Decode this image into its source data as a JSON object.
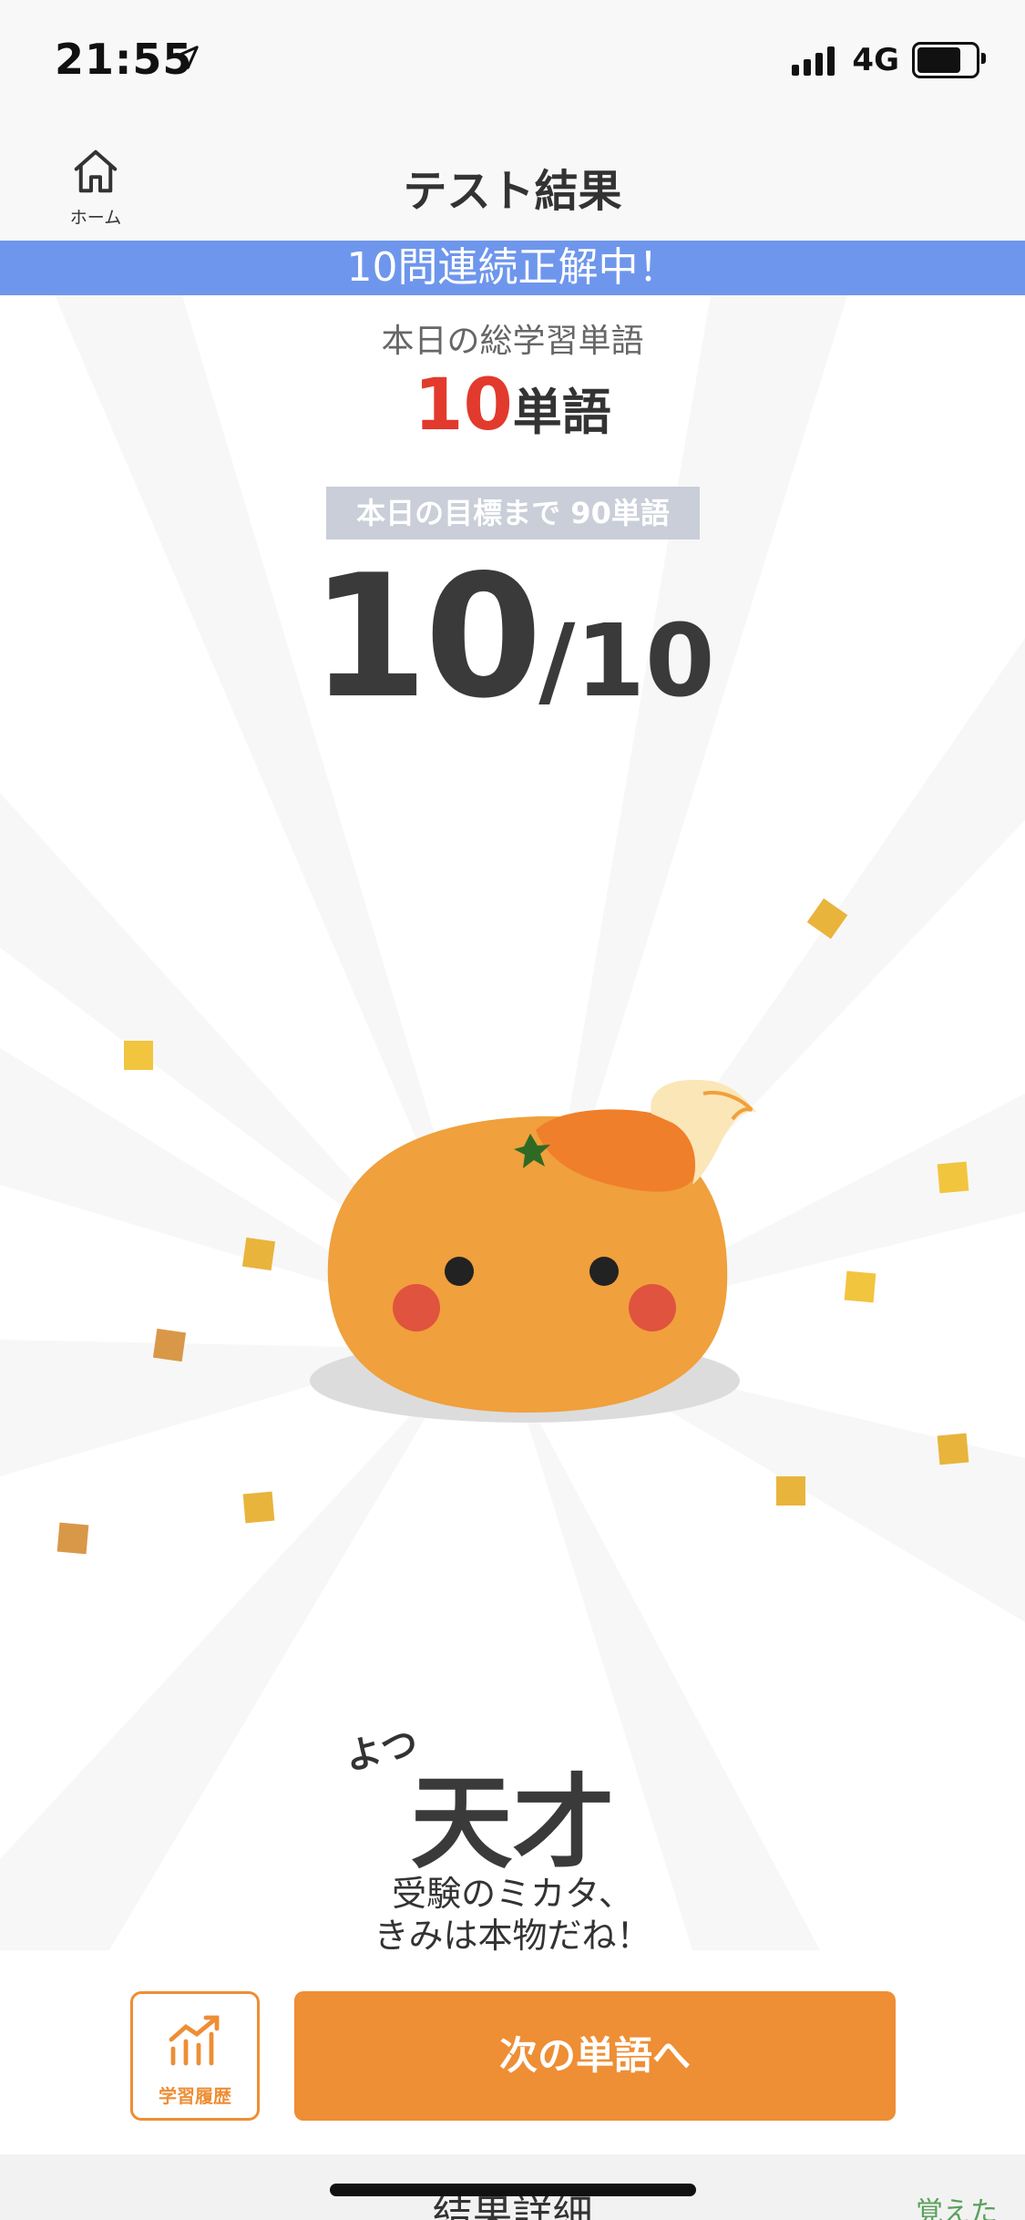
{
  "status_bar": {
    "time": "21:55",
    "network": "4G",
    "battery_level": 0.75
  },
  "nav": {
    "home_label": "ホーム",
    "title": "テスト結果"
  },
  "streak_banner": "10問連続正解中！",
  "today": {
    "label": "本日の総学習単語",
    "count": "10",
    "unit": "単語"
  },
  "goal_badge": "本日の目標まで 90単語",
  "score": {
    "correct": "10",
    "total": "/10"
  },
  "rank": {
    "ruby": "よつ",
    "title": "天才",
    "message_line1": "受験のミカタ、",
    "message_line2": "きみは本物だね！"
  },
  "buttons": {
    "history_label": "学習履歴",
    "next_label": "次の単語へ"
  },
  "bottom": {
    "title": "結果詳細",
    "right_label": "覚えた"
  },
  "colors": {
    "accent": "#ee8e35",
    "banner": "#6e96ec",
    "highlight": "#e23a2c",
    "mascot": "#f0a03c"
  },
  "icons": {
    "home": "home-icon",
    "location": "location-arrow-icon",
    "history": "chart-up-icon"
  }
}
